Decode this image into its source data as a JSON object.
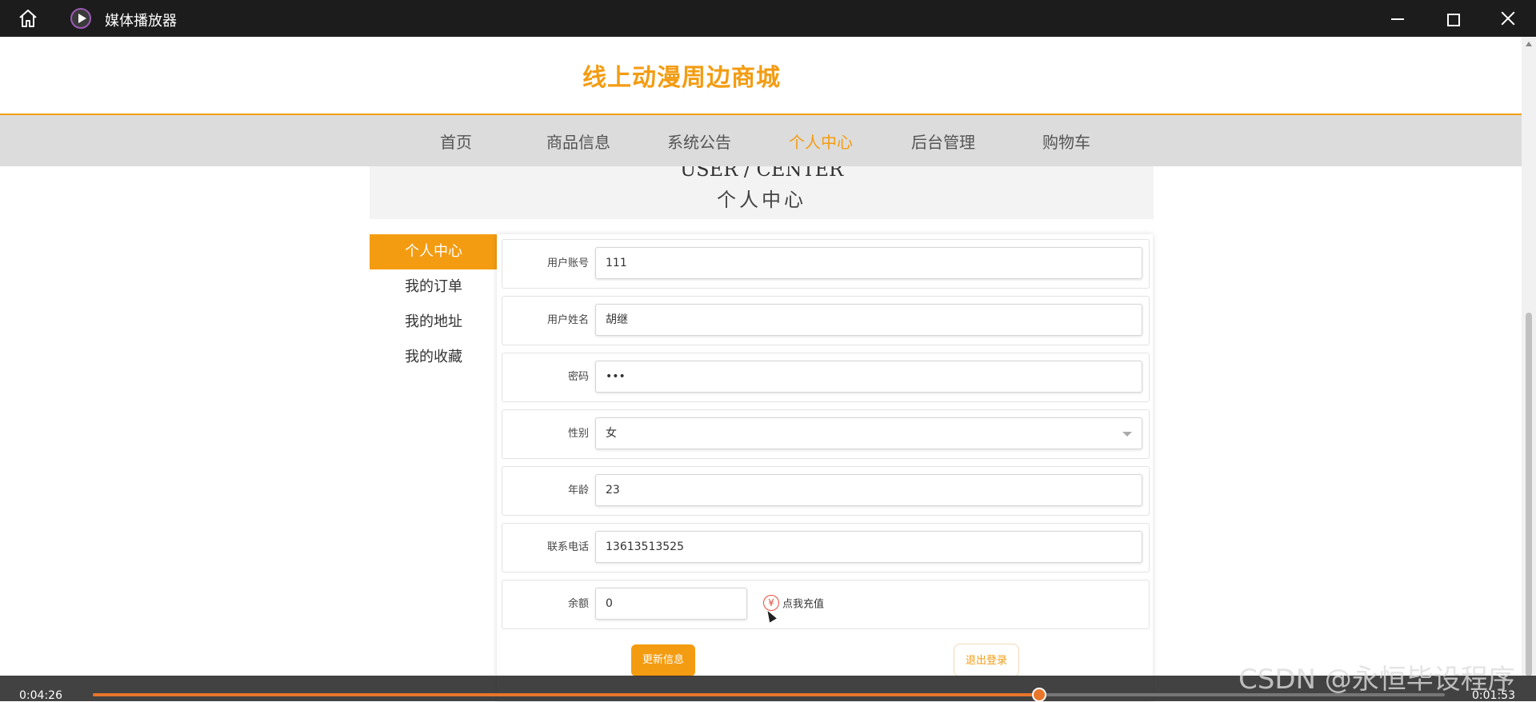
{
  "window": {
    "title": "媒体播放器"
  },
  "site": {
    "title": "线上动漫周边商城"
  },
  "nav": {
    "items": [
      {
        "label": "首页",
        "active": false
      },
      {
        "label": "商品信息",
        "active": false
      },
      {
        "label": "系统公告",
        "active": false
      },
      {
        "label": "个人中心",
        "active": true
      },
      {
        "label": "后台管理",
        "active": false
      },
      {
        "label": "购物车",
        "active": false
      }
    ]
  },
  "section": {
    "title_en": "USER / CENTER",
    "title_cn": "个人中心"
  },
  "sidebar": {
    "items": [
      {
        "label": "个人中心",
        "active": true
      },
      {
        "label": "我的订单",
        "active": false
      },
      {
        "label": "我的地址",
        "active": false
      },
      {
        "label": "我的收藏",
        "active": false
      }
    ]
  },
  "form": {
    "account": {
      "label": "用户账号",
      "value": "111"
    },
    "name": {
      "label": "用户姓名",
      "value": "胡继"
    },
    "password": {
      "label": "密码",
      "value": "•••"
    },
    "gender": {
      "label": "性别",
      "value": "女"
    },
    "age": {
      "label": "年龄",
      "value": "23"
    },
    "phone": {
      "label": "联系电话",
      "value": "13613513525"
    },
    "balance": {
      "label": "余额",
      "value": "0",
      "recharge_label": "点我充值",
      "recharge_icon": "¥"
    },
    "update_label": "更新信息",
    "logout_label": "退出登录"
  },
  "player": {
    "current_time": "0:04:26",
    "remaining_time": "0:01:53",
    "progress": 0.7
  },
  "watermark": "CSDN @永恒毕设程序",
  "colors": {
    "accent": "#f39c12",
    "titlebar": "#1c1c1c",
    "nav_bg": "#dcdcdc",
    "progress": "#e8762b"
  }
}
